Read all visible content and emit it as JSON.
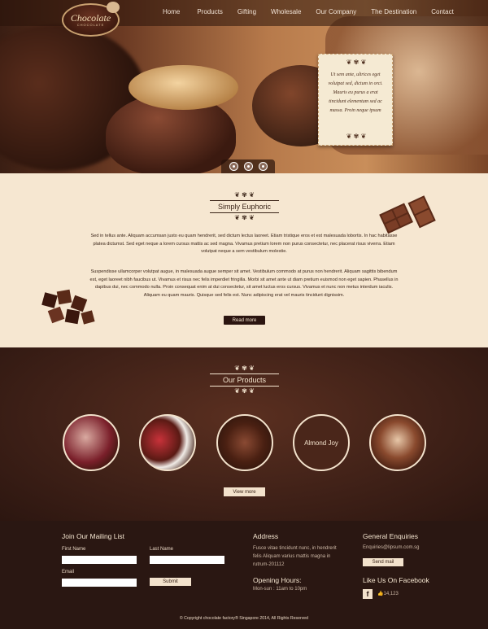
{
  "brand": {
    "logo_text": "Chocolate",
    "logo_sub": "CHOCOLATE"
  },
  "nav": [
    "Home",
    "Products",
    "Gifting",
    "Wholesale",
    "Our Company",
    "The Destination",
    "Contact"
  ],
  "hero": {
    "quote": "Ut sem ante, ultrices eget volutpat sed, dictum in orci. Mauris eu purus a erat tincidunt elementum sed ac massa. Proin neque ipsum"
  },
  "euphoric": {
    "title": "Simply Euphoric",
    "p1": "Sed in tellus ante. Aliquam accumsan justo eu quam hendrerit, sed dictum lectus laoreet. Etiam tristique eros et est malesuada lobortis. In hac habitasse platea dictumst. Sed eget neque a lorem cursus mattis ac sed magna. Vivamus pretium lorem non purus consectetur, nec placerat risus viverra. Etiam volutpat neque a sem vestibulum molestie.",
    "p2": "Suspendisse ullamcorper volutpat augue, in malesuada augue semper sit amet. Vestibulum commodo at purus non hendrerit. Aliquam sagittis bibendum est, eget laoreet nibh faucibus ut. Vivamus et risus nec felis imperdiet fringilla. Morbi sit amet ante ut diam pretium euismod non eget sapien. Phasellus in dapibus dui, nec commodo nulla. Proin consequat enim at dui consectetur, sit amet luctus eros cursus. Vivamus et nunc non metus interdum iaculis. Aliquam eu quam mauris. Quisque sed felis est. Nunc adipiscing erat vel mauris tincidunt dignissim.",
    "button": "Read more"
  },
  "products": {
    "title": "Our Products",
    "items": [
      "",
      "",
      "",
      "Almond Joy",
      ""
    ],
    "button": "View more"
  },
  "footer": {
    "mailing": {
      "heading": "Join Our Mailing List",
      "first": "First Name",
      "last": "Last Name",
      "email": "Email",
      "submit": "Submit"
    },
    "address": {
      "heading": "Address",
      "text": "Fusce vitae tincidunt nunc, in hendrerit felis Aliquam varius mattis magna in rutrum-201112"
    },
    "hours": {
      "heading": "Opening Hours:",
      "text": "Mon-sun : 11am to 10pm"
    },
    "enquiries": {
      "heading": "General Enquiries",
      "email": "Enquiries@lipsum.com.sg",
      "button": "Send mail"
    },
    "facebook": {
      "heading": "Like Us On Facebook",
      "likes": "14,123"
    },
    "copyright": "© Copyright chocolate factory® Singapore 2014, All Rights Reserved"
  }
}
